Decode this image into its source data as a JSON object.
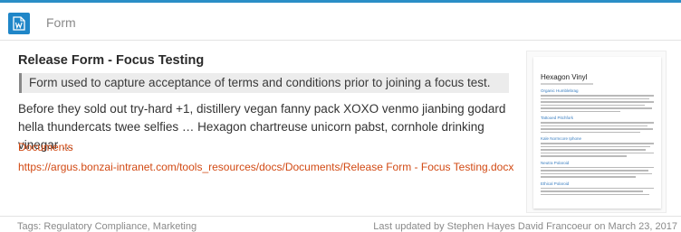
{
  "header": {
    "type_icon": "word-document-icon",
    "type_label": "Form"
  },
  "card": {
    "title": "Release Form - Focus Testing",
    "description": "Form used to capture acceptance of terms and conditions prior to joining a focus test.",
    "body": "Before they sold out try-hard +1, distillery vegan fanny pack XOXO venmo jianbing godard hella thundercats twee selfies … Hexagon chartreuse unicorn pabst, cornhole drinking vinegar …",
    "category": "Documents",
    "document_url": "https://argus.bonzai-intranet.com/tools_resources/docs/Documents/Release Form - Focus Testing.docx"
  },
  "thumbnail": {
    "title": "Hexagon Vinyl",
    "headings": [
      "Organic Humblebrag",
      "Tattooed Pitchfork",
      "Kale Normcore Iphone",
      "Neutra Polaroid",
      "Ethical Polaroid"
    ]
  },
  "footer": {
    "tags": "Tags: Regulatory Compliance, Marketing",
    "updated": "Last updated by Stephen Hayes David Francoeur on March 23, 2017"
  },
  "colors": {
    "accent": "#2a8ec6",
    "link": "#d24a14"
  }
}
